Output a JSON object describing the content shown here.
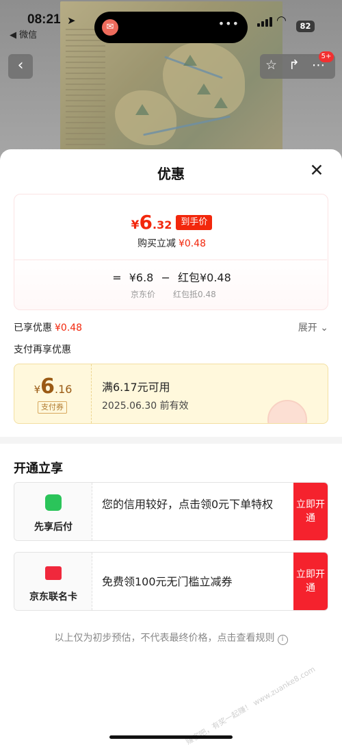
{
  "status": {
    "time": "08:21",
    "back_app": "◀ 微信",
    "battery": "82"
  },
  "nav": {
    "badge": "5+"
  },
  "sheet": {
    "title": "优惠",
    "price_card": {
      "yen": "¥",
      "price_int": "6",
      "price_dec": ".32",
      "tag": "到手价",
      "direct_label": "购买立减",
      "direct_amount": "¥0.48",
      "formula": {
        "equals": "=",
        "base": "¥6.8",
        "minus": "−",
        "red_packet": "红包¥0.48"
      },
      "base_label": "京东价",
      "red_label": "红包抵0.48"
    },
    "applied": {
      "label": "已享优惠",
      "amount": "¥0.48",
      "expand": "展开 ⌄"
    },
    "pay_title": "支付再享优惠",
    "coupon": {
      "yen": "¥",
      "price_int": "6",
      "price_dec": ".16",
      "type": "支付券",
      "condition": "满6.17元可用",
      "validity": "2025.06.30 前有效"
    },
    "open_title": "开通立享",
    "promos": [
      {
        "name": "先享后付",
        "text": "您的信用较好，点击领0元下单特权",
        "button": "立即开通",
        "icon_color": "#2bc45a"
      },
      {
        "name": "京东联名卡",
        "text": "免费领100元无门槛立减券",
        "button": "立即开通",
        "icon_color": "#f0283c"
      }
    ],
    "disclaimer": "以上仅为初步预估，不代表最终价格，点击查看规则"
  },
  "watermark": "赚客吧，有奖一起赚！ www.zuanke8.com"
}
